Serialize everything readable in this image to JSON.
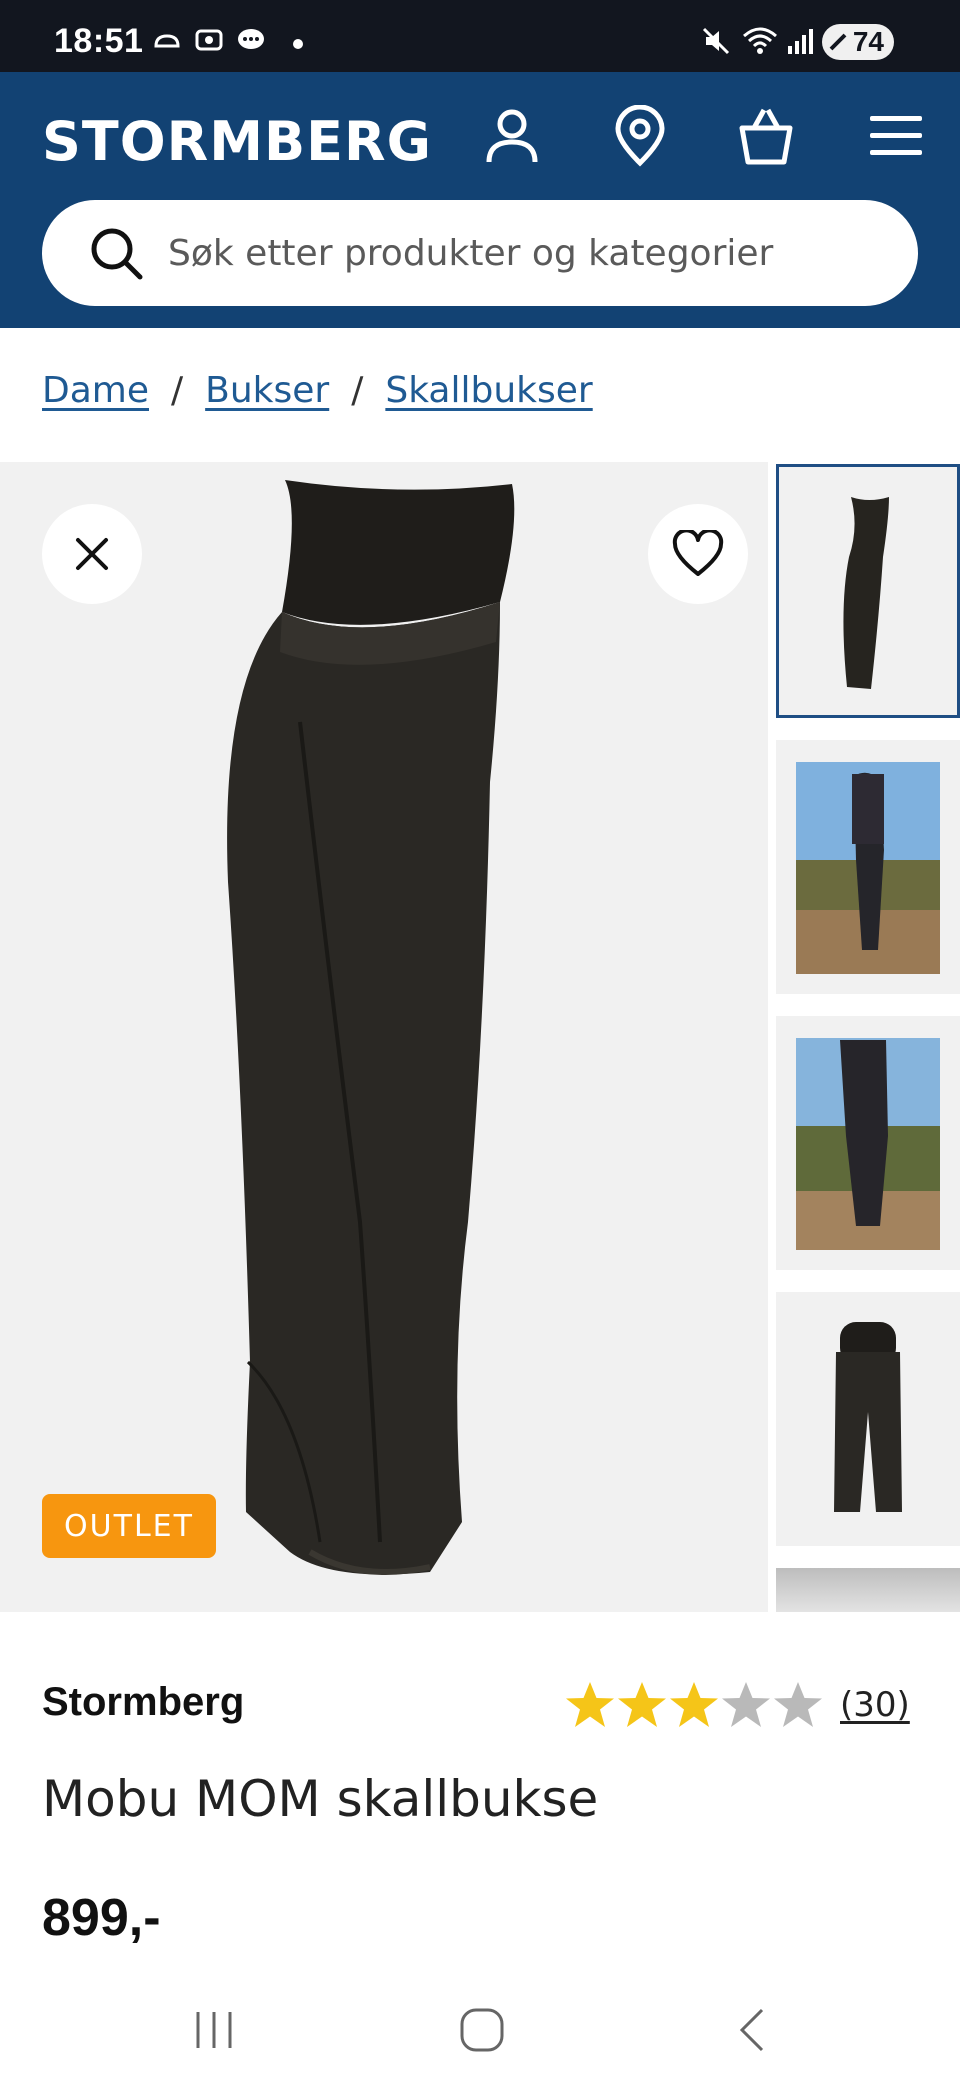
{
  "status_bar": {
    "time": "18:51",
    "battery": "74"
  },
  "header": {
    "logo": "STORMBERG",
    "search_placeholder": "Søk etter produkter og kategorier",
    "icons": [
      "account-icon",
      "store-locator-icon",
      "cart-icon",
      "menu-icon"
    ]
  },
  "breadcrumb": {
    "items": [
      "Dame",
      "Bukser",
      "Skallbukser"
    ],
    "separator": "/"
  },
  "gallery": {
    "badge": "OUTLET",
    "thumbnail_count": 5,
    "selected_index": 0
  },
  "product": {
    "brand": "Stormberg",
    "rating": 3,
    "rating_max": 5,
    "review_count": "(30)",
    "name": "Mobu MOM skallbukse",
    "price": "899,-"
  },
  "colors": {
    "header_bg": "#124273",
    "accent_link": "#1f5a93",
    "badge": "#f7960f",
    "star_filled": "#f5c518",
    "star_empty": "#b9b9b9"
  }
}
